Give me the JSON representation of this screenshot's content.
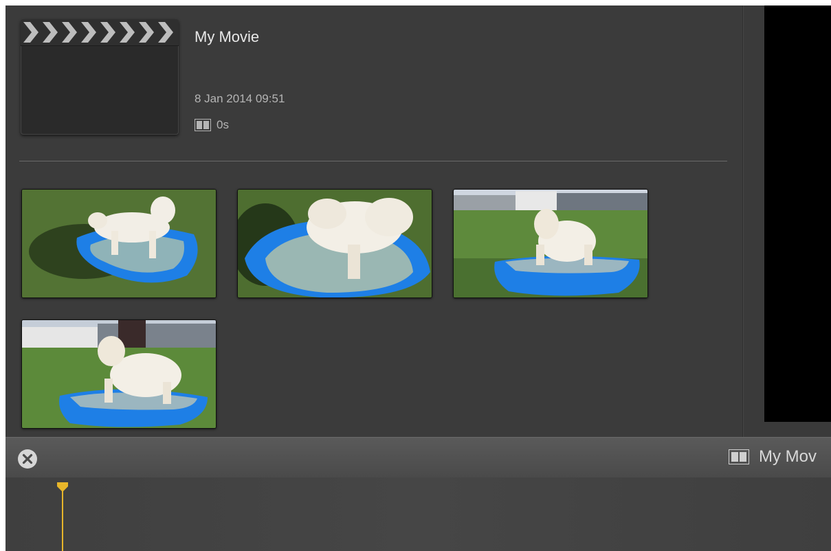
{
  "project": {
    "title": "My Movie",
    "date": "8 Jan 2014 09:51",
    "duration": "0s"
  },
  "clips": [
    {
      "label": "clip-1"
    },
    {
      "label": "clip-2"
    },
    {
      "label": "clip-3"
    },
    {
      "label": "clip-4"
    }
  ],
  "toolbar": {
    "title": "My Mov",
    "close_icon": "close-circle-icon",
    "film_icon": "film-strip-icon"
  },
  "timeline": {
    "playhead_color": "#e8b62a"
  },
  "colors": {
    "background": "#3a3a3a",
    "accent": "#e8b62a",
    "pool_blue": "#1e7fe6"
  }
}
